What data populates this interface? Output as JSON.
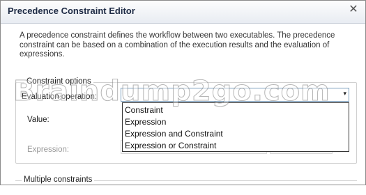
{
  "window": {
    "title": "Precedence Constraint Editor",
    "close_glyph": "✕"
  },
  "description": "A precedence constraint defines the workflow between two executables. The precedence constraint can be based on a combination of the execution results and the evaluation of expressions.",
  "constraint_options": {
    "legend": "Constraint options",
    "evaluation_label": "Evaluation operation:",
    "value_label": "Value:",
    "expression_label": "Expression:",
    "dropdown_arrow": "▾",
    "options": [
      "Constraint",
      "Expression",
      "Expression and Constraint",
      "Expression or Constraint"
    ]
  },
  "multiple_constraints": {
    "legend": "Multiple constraints"
  },
  "watermark": "Braindump2go.com"
}
